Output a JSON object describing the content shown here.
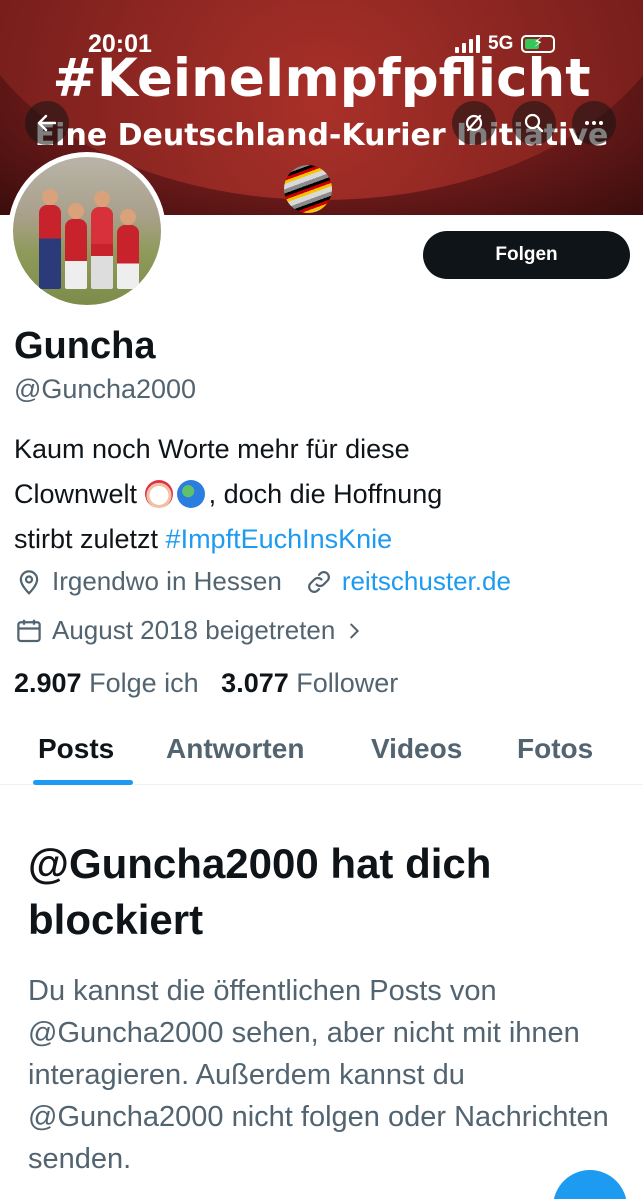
{
  "status_bar": {
    "time": "20:01",
    "network": "5G"
  },
  "banner": {
    "title": "#KeineImpfpflicht",
    "subtitle": "Eine Deutschland-Kurier Initiative"
  },
  "profile": {
    "follow_label": "Folgen",
    "name": "Guncha",
    "handle": "@Guncha2000",
    "bio_line1": "Kaum noch Worte mehr für diese",
    "bio_line2_start": "Clownwelt",
    "bio_line2_end": ", doch die Hoffnung",
    "bio_line3_start": "stirbt zuletzt ",
    "bio_hashtag": "#ImpftEuchInsKnie",
    "location": "Irgendwo in Hessen",
    "website": "reitschuster.de",
    "joined": "August 2018 beigetreten",
    "following_count": "2.907",
    "following_label": "Folge ich",
    "followers_count": "3.077",
    "followers_label": "Follower"
  },
  "tabs": [
    "Posts",
    "Antworten",
    "Videos",
    "Fotos"
  ],
  "blocked": {
    "title": "@Guncha2000 hat dich blockiert",
    "text": "Du kannst die öffentlichen Posts von @Guncha2000 sehen, aber nicht mit ihnen interagieren. Außerdem kannst du @Guncha2000 nicht folgen oder Nachrichten senden."
  },
  "colors": {
    "accent": "#1d9bf0",
    "text": "#0f1419",
    "muted": "#536471",
    "banner": "#7c201d"
  },
  "icons": [
    "back-arrow-icon",
    "slashed-circle-icon",
    "search-icon",
    "more-icon",
    "location-pin-icon",
    "link-icon",
    "calendar-icon",
    "chevron-right-icon"
  ]
}
